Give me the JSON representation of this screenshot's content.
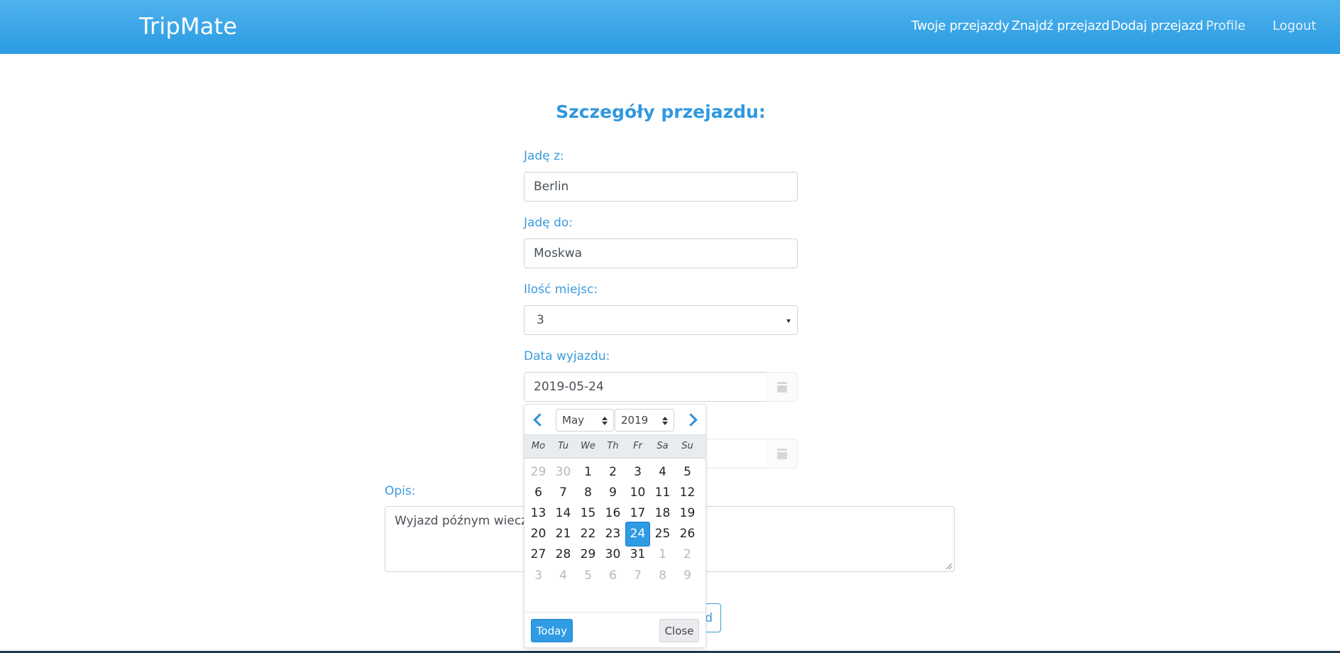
{
  "navbar": {
    "brand": "TripMate",
    "links": [
      "Twoje przejazdy",
      "Znajdź przejazd",
      "Dodaj przejazd",
      "Profile",
      "Logout"
    ]
  },
  "page": {
    "title": "Szczegóły przejazdu:"
  },
  "form": {
    "from_label": "Jadę z:",
    "from_value": "Berlin",
    "to_label": "Jadę do:",
    "to_value": "Moskwa",
    "seats_label": "Ilość miejsc:",
    "seats_value": "3",
    "date_label": "Data wyjazdu:",
    "date_value": "2019-05-24",
    "description_label": "Opis:",
    "description_value": "Wyjazd późnym wieczo",
    "submit_label": "d"
  },
  "datepicker": {
    "month": "May",
    "year": "2019",
    "weekdays": [
      "Mo",
      "Tu",
      "We",
      "Th",
      "Fr",
      "Sa",
      "Su"
    ],
    "weeks": [
      [
        "29",
        "30",
        "1",
        "2",
        "3",
        "4",
        "5"
      ],
      [
        "6",
        "7",
        "8",
        "9",
        "10",
        "11",
        "12"
      ],
      [
        "13",
        "14",
        "15",
        "16",
        "17",
        "18",
        "19"
      ],
      [
        "20",
        "21",
        "22",
        "23",
        "24",
        "25",
        "26"
      ],
      [
        "27",
        "28",
        "29",
        "30",
        "31",
        "1",
        "2"
      ],
      [
        "3",
        "4",
        "5",
        "6",
        "7",
        "8",
        "9"
      ]
    ],
    "selected_day": "24",
    "today_label": "Today",
    "close_label": "Close"
  },
  "colors": {
    "navbar": "#2b9be3",
    "accent": "#3a9bde",
    "selected": "#2f9be4"
  }
}
